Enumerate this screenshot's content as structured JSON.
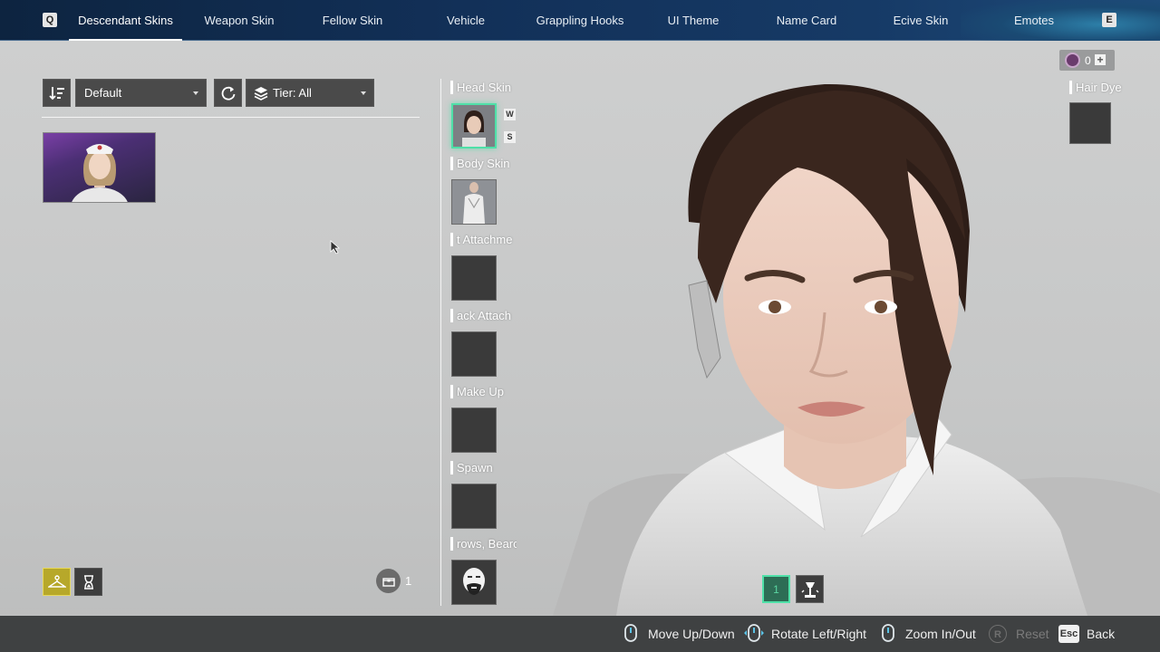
{
  "topnav": {
    "prev_key": "Q",
    "next_key": "E",
    "tabs": [
      {
        "label": "Descendant Skins"
      },
      {
        "label": "Weapon Skin"
      },
      {
        "label": "Fellow Skin"
      },
      {
        "label": "Vehicle"
      },
      {
        "label": "Grappling Hooks"
      },
      {
        "label": "UI Theme"
      },
      {
        "label": "Name Card"
      },
      {
        "label": "Ecive Skin"
      },
      {
        "label": "Emotes"
      }
    ],
    "active_index": 0
  },
  "toolbar": {
    "sort_value": "Default",
    "tier_value": "Tier: All"
  },
  "slots": [
    {
      "label": "Head Skin",
      "tags": [
        "W",
        "S"
      ],
      "selected": true
    },
    {
      "label": "Body Skin"
    },
    {
      "label": "t Attachme"
    },
    {
      "label": "ack Attach"
    },
    {
      "label": "Make Up"
    },
    {
      "label": "Spawn"
    },
    {
      "label": "rows, Bearc"
    }
  ],
  "right_panel": {
    "currency_value": "0",
    "hair_dye_label": "Hair Dye"
  },
  "inventory_count": "1",
  "pose_button_number": "1",
  "hints": [
    {
      "label": "Move Up/Down",
      "enabled": true
    },
    {
      "label": "Rotate Left/Right",
      "enabled": true
    },
    {
      "label": "Zoom In/Out",
      "enabled": true
    },
    {
      "label": "Reset",
      "key": "R",
      "enabled": false
    },
    {
      "label": "Back",
      "key": "Esc",
      "enabled": true
    }
  ],
  "colors": {
    "selected_slot": "#4fe0a8",
    "active_filter": "#b7a82a",
    "topbar": "#123058"
  }
}
